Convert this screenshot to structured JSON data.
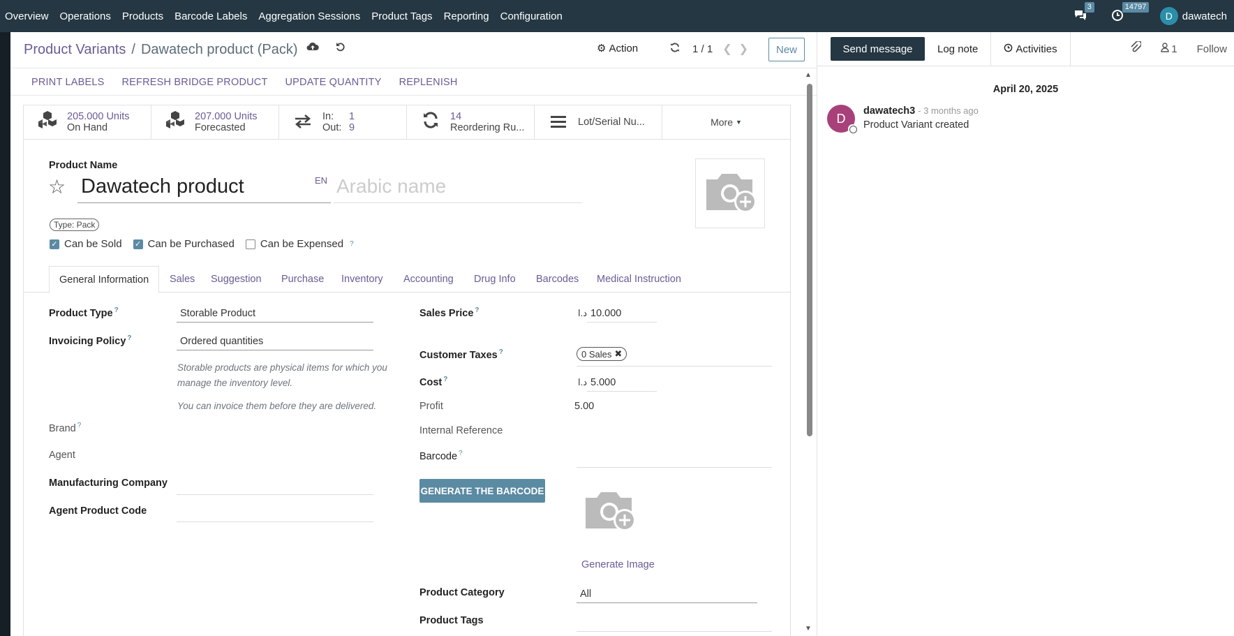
{
  "navbar": {
    "items": [
      "Overview",
      "Operations",
      "Products",
      "Barcode Labels",
      "Aggregation Sessions",
      "Product Tags",
      "Reporting",
      "Configuration"
    ],
    "messages_count": "3",
    "activities_count": "14797",
    "user_initial": "D",
    "user_name": "dawatech"
  },
  "breadcrumb": {
    "parent": "Product Variants",
    "separator": "/",
    "current": "Dawatech product (Pack)"
  },
  "control": {
    "action_label": "Action",
    "pager": "1 / 1",
    "new_label": "New"
  },
  "header_buttons": [
    "PRINT LABELS",
    "REFRESH BRIDGE PRODUCT",
    "UPDATE QUANTITY",
    "REPLENISH"
  ],
  "stats": {
    "on_hand_value": "205.000 Units",
    "on_hand_label": "On Hand",
    "forecasted_value": "207.000 Units",
    "forecasted_label": "Forecasted",
    "in_label": "In:",
    "in_value": "1",
    "out_label": "Out:",
    "out_value": "9",
    "reordering_value": "14",
    "reordering_label": "Reordering Ru...",
    "lot_label": "Lot/Serial Nu...",
    "more_label": "More"
  },
  "product": {
    "name_label": "Product Name",
    "name": "Dawatech product",
    "lang": "EN",
    "arabic_placeholder": "Arabic name",
    "type_pill": "Type: Pack",
    "can_be_sold": "Can be Sold",
    "can_be_purchased": "Can be Purchased",
    "can_be_expensed": "Can be Expensed"
  },
  "tabs": [
    "General Information",
    "Sales",
    "Suggestion",
    "Purchase",
    "Inventory",
    "Accounting",
    "Drug Info",
    "Barcodes",
    "Medical Instruction"
  ],
  "fields": {
    "product_type_label": "Product Type",
    "product_type": "Storable Product",
    "invoicing_policy_label": "Invoicing Policy",
    "invoicing_policy": "Ordered quantities",
    "note1": "Storable products are physical items for which you manage the inventory level.",
    "note2": "You can invoice them before they are delivered.",
    "brand_label": "Brand",
    "agent_label": "Agent",
    "manufacturing_company_label": "Manufacturing Company",
    "agent_product_code_label": "Agent Product Code",
    "sales_price_label": "Sales Price",
    "currency": "د.ا",
    "sales_price": "10.000",
    "customer_taxes_label": "Customer Taxes",
    "customer_tax": "0 Sales",
    "cost_label": "Cost",
    "cost": "5.000",
    "profit_label": "Profit",
    "profit": "5.00",
    "internal_reference_label": "Internal Reference",
    "barcode_label": "Barcode",
    "generate_barcode": "GENERATE THE BARCODE",
    "generate_image": "Generate Image",
    "product_category_label": "Product Category",
    "product_category": "All",
    "product_tags_label": "Product Tags"
  },
  "chatter": {
    "send_message": "Send message",
    "log_note": "Log note",
    "activities": "Activities",
    "followers_count": "1",
    "follow": "Follow",
    "date": "April 20, 2025",
    "author_initial": "D",
    "author": "dawatech3",
    "msg_date": "- 3 months ago",
    "body": "Product Variant created"
  },
  "colors": {
    "navbar": "#243743",
    "accent": "#5b8aa3",
    "link": "#6b5b95"
  }
}
